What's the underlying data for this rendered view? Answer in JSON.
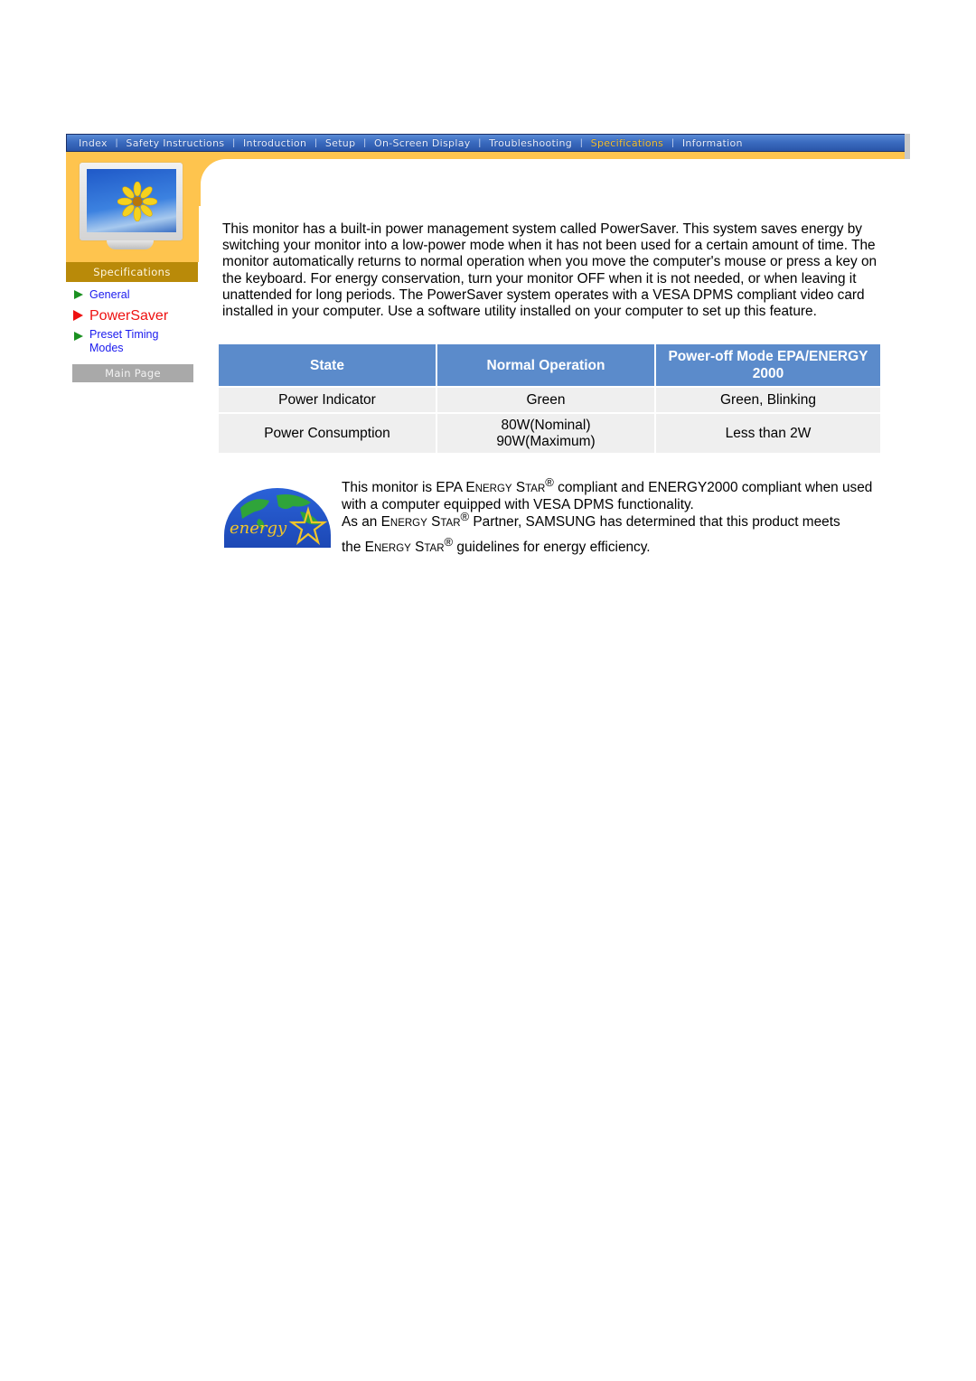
{
  "nav": {
    "items": [
      {
        "label": "Index",
        "active": false
      },
      {
        "label": "Safety Instructions",
        "active": false
      },
      {
        "label": "Introduction",
        "active": false
      },
      {
        "label": "Setup",
        "active": false
      },
      {
        "label": "On-Screen Display",
        "active": false
      },
      {
        "label": "Troubleshooting",
        "active": false
      },
      {
        "label": "Specifications",
        "active": true
      },
      {
        "label": "Information",
        "active": false
      }
    ],
    "separator": "|"
  },
  "sidebar": {
    "section_label": "Specifications",
    "items": [
      {
        "label": "General",
        "active": false
      },
      {
        "label": "PowerSaver",
        "active": true
      },
      {
        "label": "Preset Timing",
        "label2": "Modes",
        "active": false
      }
    ],
    "main_page_button": "Main Page"
  },
  "content": {
    "intro": "This monitor has a built-in power management system called PowerSaver. This system saves energy by switching your monitor into a low-power mode when it has not been used for a certain amount of time. The monitor automatically returns to normal operation when you move the computer's mouse or press a key on the keyboard. For energy conservation, turn your monitor OFF when it is not needed, or when leaving it unattended for long periods. The PowerSaver system operates with a VESA DPMS compliant video card installed in your computer. Use a software utility installed on your computer to set up this feature.",
    "table": {
      "headers": [
        "State",
        "Normal Operation",
        "Power-off Mode EPA/ENERGY",
        "2000"
      ],
      "rows": [
        {
          "state": "Power Indicator",
          "normal": "Green",
          "normal2": "",
          "poweroff": "Green, Blinking"
        },
        {
          "state": "Power Consumption",
          "normal": "80W(Nominal)",
          "normal2": "90W(Maximum)",
          "poweroff": "Less than 2W"
        }
      ]
    },
    "energy": {
      "logo_text": "energy",
      "p1_a": "This monitor is EPA ",
      "energy_sc": "ENERGY",
      "star_s": "S",
      "star_sc": "TAR",
      "reg": "®",
      "p1_b": " compliant and ENERGY2000 compliant when used with a computer equipped with VESA DPMS functionality.",
      "p2_a": "As an ",
      "p2_b": " Partner, SAMSUNG has determined that this product meets",
      "p3_a": "the ",
      "p3_b": " guidelines for energy efficiency.",
      "e": "E",
      "nergy_sc": "NERGY"
    }
  }
}
